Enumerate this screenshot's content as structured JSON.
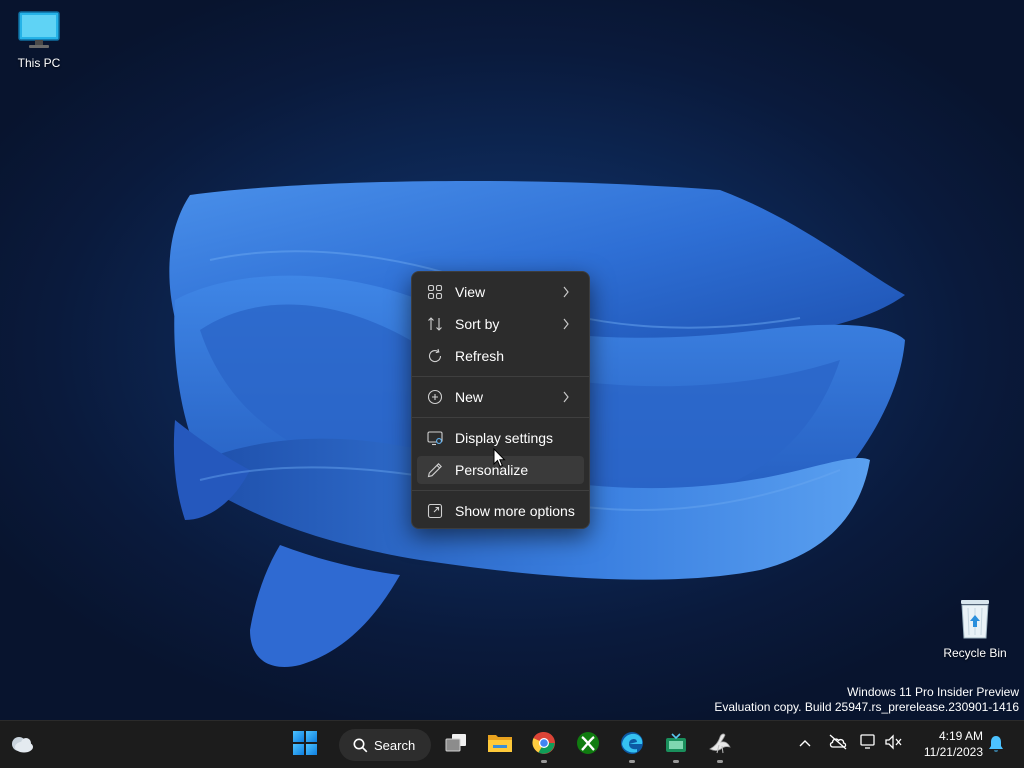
{
  "desktop": {
    "icons": [
      {
        "label": "This PC",
        "icon": "monitor-icon"
      },
      {
        "label": "Recycle Bin",
        "icon": "recycle-bin-icon"
      }
    ],
    "watermark": {
      "line1": "Windows 11 Pro Insider Preview",
      "line2": "Evaluation copy. Build 25947.rs_prerelease.230901-1416"
    }
  },
  "context_menu": {
    "items": [
      {
        "label": "View",
        "icon": "grid-view-icon",
        "has_submenu": true
      },
      {
        "label": "Sort by",
        "icon": "sort-arrows-icon",
        "has_submenu": true
      },
      {
        "label": "Refresh",
        "icon": "refresh-icon",
        "has_submenu": false
      },
      {
        "label": "New",
        "icon": "add-circle-icon",
        "has_submenu": true
      },
      {
        "label": "Display settings",
        "icon": "display-settings-icon",
        "has_submenu": false
      },
      {
        "label": "Personalize",
        "icon": "pen-icon",
        "has_submenu": false,
        "hovered": true
      },
      {
        "label": "Show more options",
        "icon": "open-external-icon",
        "has_submenu": false
      }
    ]
  },
  "taskbar": {
    "search_label": "Search",
    "apps": [
      {
        "name": "Start",
        "icon": "windows-logo-icon"
      },
      {
        "name": "Task View",
        "icon": "task-view-icon"
      },
      {
        "name": "File Explorer",
        "icon": "folder-icon"
      },
      {
        "name": "Google Chrome",
        "icon": "chrome-icon",
        "running": true
      },
      {
        "name": "Xbox",
        "icon": "xbox-icon"
      },
      {
        "name": "Microsoft Edge",
        "icon": "edge-icon",
        "running": true
      },
      {
        "name": "App",
        "icon": "green-app-icon",
        "running": true
      },
      {
        "name": "App",
        "icon": "bird-app-icon",
        "running": true
      }
    ],
    "tray": {
      "time": "4:19 AM",
      "date": "11/21/2023"
    }
  },
  "colors": {
    "taskbar_bg": "#1c1c1c",
    "menu_bg": "#2c2c2c",
    "accent": "#0078d4",
    "wallpaper_blue": "#2f6fd6"
  }
}
